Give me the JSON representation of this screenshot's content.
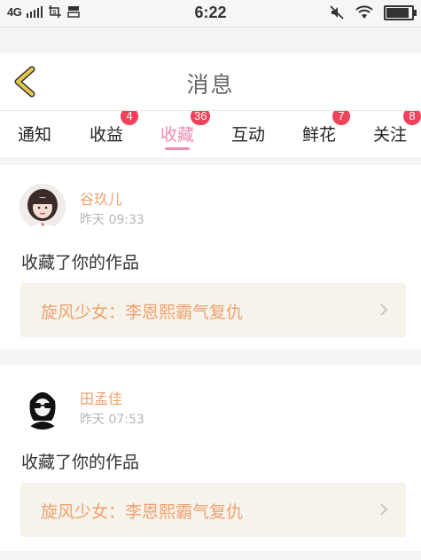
{
  "status_bar": {
    "network": "4G",
    "time": "6:22",
    "battery_level": 0.95
  },
  "header": {
    "title": "消息"
  },
  "tabs": [
    {
      "label": "通知",
      "badge": ""
    },
    {
      "label": "收益",
      "badge": "4"
    },
    {
      "label": "收藏",
      "badge": "36",
      "active": true
    },
    {
      "label": "互动",
      "badge": ""
    },
    {
      "label": "鲜花",
      "badge": "7"
    },
    {
      "label": "关注",
      "badge": "8"
    }
  ],
  "messages": [
    {
      "user": "谷玖儿",
      "time": "昨天 09:33",
      "action": "收藏了你的作品",
      "work_title": "旋风少女：李恩熙霸气复仇"
    },
    {
      "user": "田孟佳",
      "time": "昨天 07:53",
      "action": "收藏了你的作品",
      "work_title": "旋风少女：李恩熙霸气复仇"
    }
  ],
  "colors": {
    "accent_pink": "#f28cb3",
    "orange_text": "#f2a06f",
    "badge_red": "#f0435a",
    "back_arrow": "#e6c84a"
  }
}
